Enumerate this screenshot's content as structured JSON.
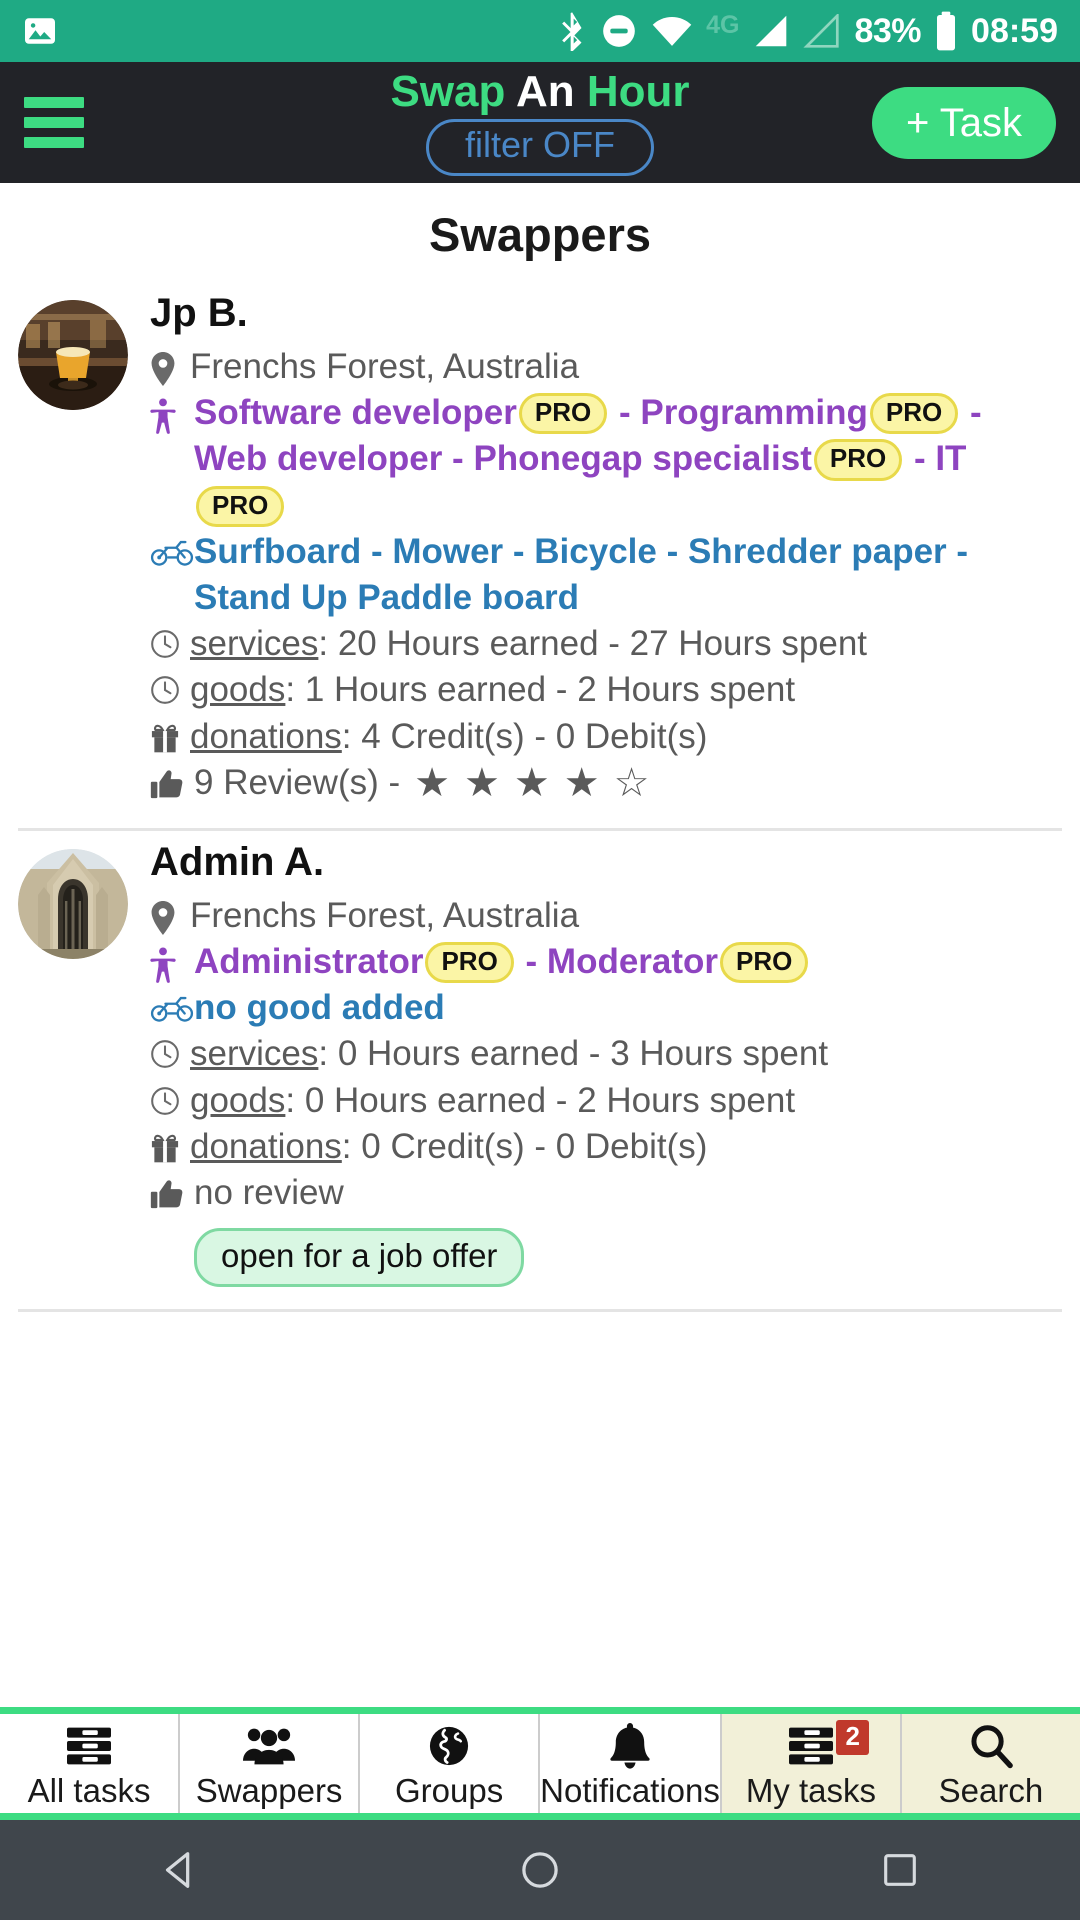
{
  "statusbar": {
    "left_icons": [
      "image-icon"
    ],
    "icons": [
      "bluetooth-icon",
      "do-not-disturb-icon",
      "wifi-icon"
    ],
    "network_label": "4G",
    "battery_percent": "83%",
    "time": "08:59"
  },
  "header": {
    "menu_icon": "hamburger-menu-icon",
    "brand_part1": "Swap",
    "brand_part2": "An",
    "brand_part3": "Hour",
    "filter_label": "filter OFF",
    "add_task_label": "+ Task",
    "brand_green": "#3ddc82",
    "bar_background": "#222328"
  },
  "page": {
    "title": "Swappers"
  },
  "swappers": [
    {
      "name": "Jp B.",
      "avatar": "cafe-beer-photo",
      "location_icon": "map-pin-icon",
      "location": "Frenchs Forest, Australia",
      "skills_icon": "person-icon",
      "skills": [
        {
          "label": "Software developer",
          "pro": true
        },
        {
          "label": "Programming",
          "pro": true
        },
        {
          "label": "Web developer",
          "pro": false
        },
        {
          "label": "Phonegap specialist",
          "pro": true
        },
        {
          "label": "IT",
          "pro": true
        }
      ],
      "goods_icon": "bicycle-icon",
      "goods": "Surfboard - Mower - Bicycle - Shredder paper - Stand Up Paddle board",
      "stats": [
        {
          "icon": "clock-icon",
          "label": "services",
          "value": "20 Hours earned - 27 Hours spent"
        },
        {
          "icon": "clock-icon",
          "label": "goods",
          "value": "1 Hours earned - 2 Hours spent"
        },
        {
          "icon": "gift-icon",
          "label": "donations",
          "value": "4 Credit(s) - 0 Debit(s)"
        }
      ],
      "review_icon": "thumbs-up-icon",
      "review_text": "9 Review(s) -",
      "stars_filled": 4,
      "stars_total": 5,
      "job_offer": null
    },
    {
      "name": "Admin A.",
      "avatar": "cathedral-photo",
      "location_icon": "map-pin-icon",
      "location": "Frenchs Forest, Australia",
      "skills_icon": "person-icon",
      "skills": [
        {
          "label": "Administrator",
          "pro": true
        },
        {
          "label": "Moderator",
          "pro": true
        }
      ],
      "goods_icon": "bicycle-icon",
      "goods": "no good added",
      "stats": [
        {
          "icon": "clock-icon",
          "label": "services",
          "value": "0 Hours earned - 3 Hours spent"
        },
        {
          "icon": "clock-icon",
          "label": "goods",
          "value": "0 Hours earned - 2 Hours spent"
        },
        {
          "icon": "gift-icon",
          "label": "donations",
          "value": "0 Credit(s) - 0 Debit(s)"
        }
      ],
      "review_icon": "thumbs-up-icon",
      "review_text": "no review",
      "stars_filled": 0,
      "stars_total": 0,
      "job_offer": "open for a job offer"
    }
  ],
  "bottom_nav": {
    "items": [
      {
        "label": "All tasks",
        "icon": "list-icon",
        "active": false,
        "badge": null
      },
      {
        "label": "Swappers",
        "icon": "people-icon",
        "active": false,
        "badge": null
      },
      {
        "label": "Groups",
        "icon": "globe-icon",
        "active": false,
        "badge": null
      },
      {
        "label": "Notifications",
        "icon": "bell-icon",
        "active": false,
        "badge": null
      },
      {
        "label": "My tasks",
        "icon": "list-icon",
        "active": true,
        "badge": "2"
      },
      {
        "label": "Search",
        "icon": "search-icon",
        "active": true,
        "badge": null
      }
    ],
    "accent_color": "#3ddc82",
    "active_background": "#f2f0d8",
    "badge_color": "#c0392b"
  },
  "android_nav": {
    "back": "back-triangle-icon",
    "home": "home-circle-icon",
    "recents": "recents-square-icon"
  }
}
